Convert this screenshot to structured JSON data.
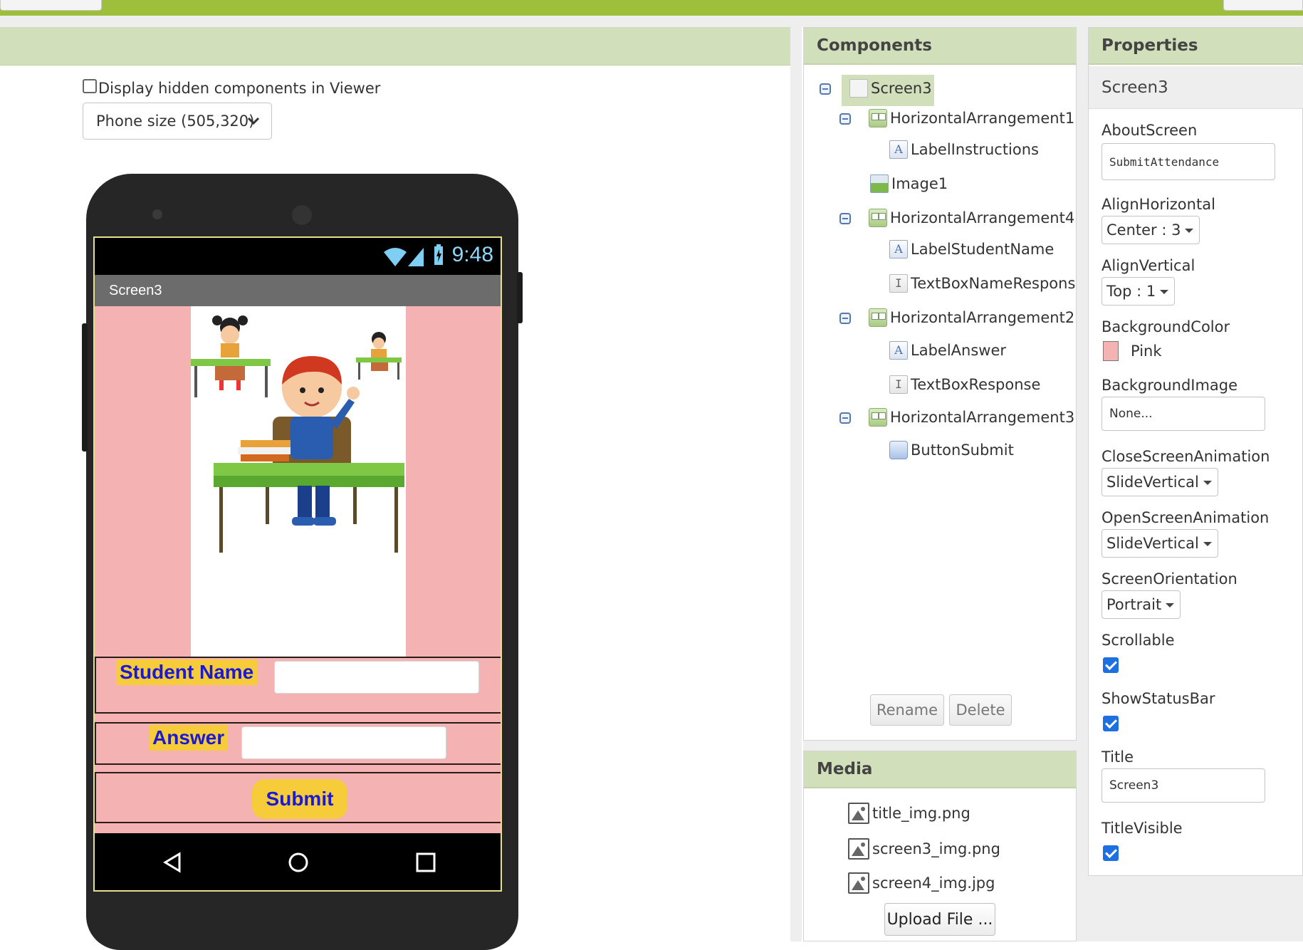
{
  "viewer": {
    "hidden_components_label": "Display hidden components in Viewer",
    "phone_size_select": "Phone size (505,320)"
  },
  "phone": {
    "status_time": "9:48",
    "screen_title": "Screen3",
    "student_name_label": "Student Name",
    "answer_label": "Answer",
    "submit_label": "Submit"
  },
  "components": {
    "header": "Components",
    "tree": [
      {
        "name": "Screen3",
        "icon": "screen-icon"
      },
      {
        "name": "HorizontalArrangement1",
        "icon": "horizontal-arrangement-icon"
      },
      {
        "name": "LabelInstructions",
        "icon": "label-icon"
      },
      {
        "name": "Image1",
        "icon": "image-icon"
      },
      {
        "name": "HorizontalArrangement4",
        "icon": "horizontal-arrangement-icon"
      },
      {
        "name": "LabelStudentName",
        "icon": "label-icon"
      },
      {
        "name": "TextBoxNameRespons",
        "icon": "textbox-icon"
      },
      {
        "name": "HorizontalArrangement2",
        "icon": "horizontal-arrangement-icon"
      },
      {
        "name": "LabelAnswer",
        "icon": "label-icon"
      },
      {
        "name": "TextBoxResponse",
        "icon": "textbox-icon"
      },
      {
        "name": "HorizontalArrangement3",
        "icon": "horizontal-arrangement-icon"
      },
      {
        "name": "ButtonSubmit",
        "icon": "button-icon"
      }
    ],
    "rename_button": "Rename",
    "delete_button": "Delete"
  },
  "media": {
    "header": "Media",
    "files": [
      "title_img.png",
      "screen3_img.png",
      "screen4_img.jpg"
    ],
    "upload_button": "Upload File ..."
  },
  "properties": {
    "header": "Properties",
    "component": "Screen3",
    "about_screen_label": "AboutScreen",
    "about_screen_value": "SubmitAttendance",
    "align_horizontal_label": "AlignHorizontal",
    "align_horizontal_value": "Center : 3",
    "align_vertical_label": "AlignVertical",
    "align_vertical_value": "Top : 1",
    "background_color_label": "BackgroundColor",
    "background_color_value": "Pink",
    "background_color_hex": "#f4b3b2",
    "background_image_label": "BackgroundImage",
    "background_image_value": "None...",
    "close_anim_label": "CloseScreenAnimation",
    "close_anim_value": "SlideVertical",
    "open_anim_label": "OpenScreenAnimation",
    "open_anim_value": "SlideVertical",
    "orientation_label": "ScreenOrientation",
    "orientation_value": "Portrait",
    "scrollable_label": "Scrollable",
    "scrollable_checked": true,
    "show_status_bar_label": "ShowStatusBar",
    "show_status_bar_checked": true,
    "title_label": "Title",
    "title_value": "Screen3",
    "title_visible_label": "TitleVisible",
    "title_visible_checked": true
  }
}
